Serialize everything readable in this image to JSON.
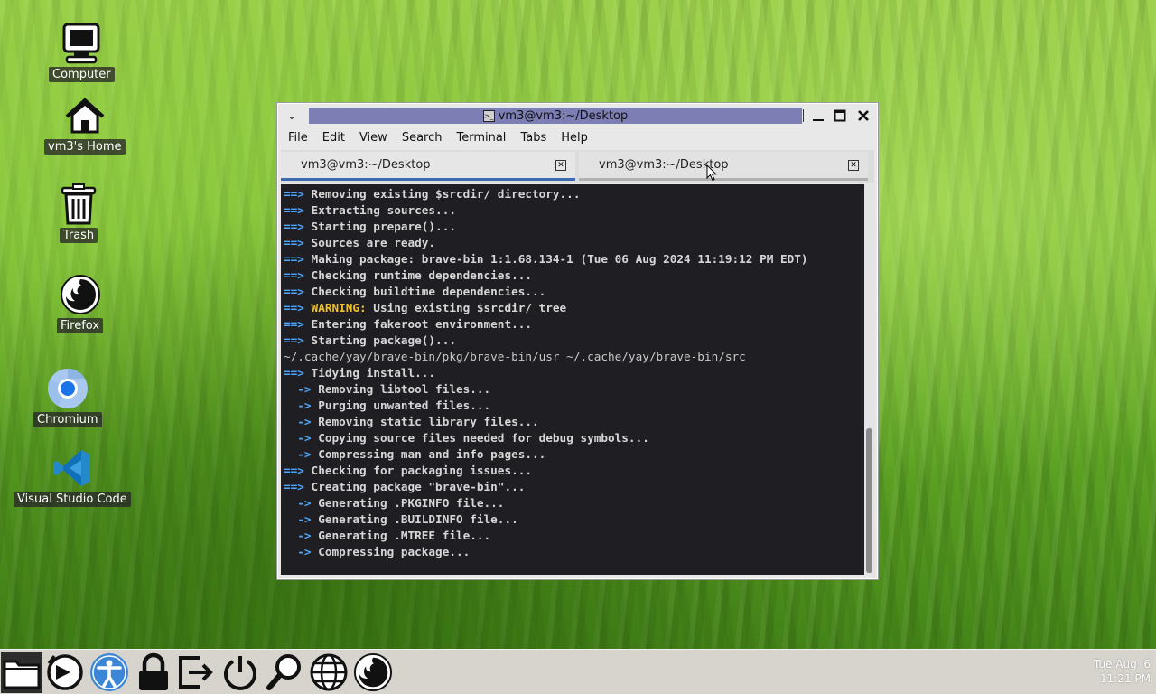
{
  "desktop": {
    "icons": [
      {
        "label": "Computer",
        "icon": "computer-icon"
      },
      {
        "label": "vm3's Home",
        "icon": "home-icon"
      },
      {
        "label": "Trash",
        "icon": "trash-icon"
      },
      {
        "label": "Firefox",
        "icon": "firefox-icon"
      },
      {
        "label": "Chromium",
        "icon": "chromium-icon"
      },
      {
        "label": "Visual Studio Code",
        "icon": "vscode-icon"
      }
    ]
  },
  "window": {
    "title": "vm3@vm3:~/Desktop",
    "title_bar_color": "#7c7eb4",
    "menu": [
      "File",
      "Edit",
      "View",
      "Search",
      "Terminal",
      "Tabs",
      "Help"
    ],
    "tabs": [
      {
        "label": "vm3@vm3:~/Desktop",
        "active": true
      },
      {
        "label": "vm3@vm3:~/Desktop",
        "active": false
      }
    ],
    "scroll_position": 0.95
  },
  "terminal": {
    "lines": [
      {
        "prefix": "==>",
        "text": " Removing existing $srcdir/ directory..."
      },
      {
        "prefix": "==>",
        "text": " Extracting sources..."
      },
      {
        "prefix": "==>",
        "text": " Starting prepare()..."
      },
      {
        "prefix": "==>",
        "text": " Sources are ready."
      },
      {
        "prefix": "==>",
        "text": " Making package: brave-bin 1:1.68.134-1 (Tue 06 Aug 2024 11:19:12 PM EDT)"
      },
      {
        "prefix": "==>",
        "text": " Checking runtime dependencies..."
      },
      {
        "prefix": "==>",
        "text": " Checking buildtime dependencies..."
      },
      {
        "prefix": "==>",
        "warn": " WARNING:",
        "text": " Using existing $srcdir/ tree"
      },
      {
        "prefix": "==>",
        "text": " Entering fakeroot environment..."
      },
      {
        "prefix": "==>",
        "text": " Starting package()..."
      },
      {
        "prefix": "",
        "text": "~/.cache/yay/brave-bin/pkg/brave-bin/usr ~/.cache/yay/brave-bin/src",
        "plain": true
      },
      {
        "prefix": "==>",
        "text": " Tidying install..."
      },
      {
        "prefix": "  ->",
        "text": " Removing libtool files..."
      },
      {
        "prefix": "  ->",
        "text": " Purging unwanted files..."
      },
      {
        "prefix": "  ->",
        "text": " Removing static library files..."
      },
      {
        "prefix": "  ->",
        "text": " Copying source files needed for debug symbols..."
      },
      {
        "prefix": "  ->",
        "text": " Compressing man and info pages..."
      },
      {
        "prefix": "==>",
        "text": " Checking for packaging issues..."
      },
      {
        "prefix": "==>",
        "text": " Creating package \"brave-bin\"..."
      },
      {
        "prefix": "  ->",
        "text": " Generating .PKGINFO file..."
      },
      {
        "prefix": "  ->",
        "text": " Generating .BUILDINFO file..."
      },
      {
        "prefix": "  ->",
        "text": " Generating .MTREE file..."
      },
      {
        "prefix": "  ->",
        "text": " Compressing package..."
      }
    ]
  },
  "taskbar": {
    "icons": [
      "file-manager-icon",
      "session-restore-icon",
      "accessibility-icon",
      "lock-icon",
      "logout-icon",
      "power-icon",
      "search-icon",
      "web-browser-icon",
      "firefox-icon"
    ],
    "clock_date": "Tue Aug  6",
    "clock_time": "11:21 PM"
  }
}
